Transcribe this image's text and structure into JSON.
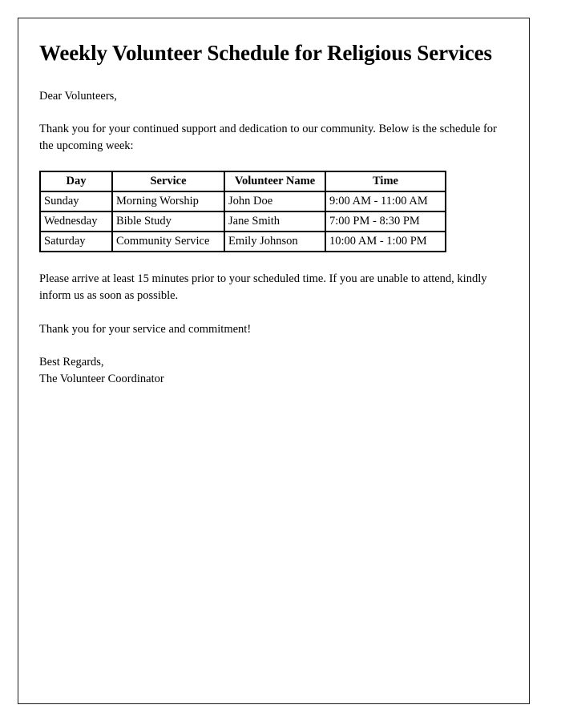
{
  "document": {
    "title": "Weekly Volunteer Schedule for Religious Services",
    "salutation": "Dear Volunteers,",
    "intro_paragraph": "Thank you for your continued support and dedication to our community. Below is the schedule for the upcoming week:",
    "notice_paragraph": "Please arrive at least 15 minutes prior to your scheduled time. If you are unable to attend, kindly inform us as soon as possible.",
    "thanks_paragraph": "Thank you for your service and commitment!",
    "signoff": "Best Regards,",
    "signer": "The Volunteer Coordinator"
  },
  "schedule_table": {
    "headers": {
      "day": "Day",
      "service": "Service",
      "volunteer": "Volunteer Name",
      "time": "Time"
    },
    "rows": [
      {
        "day": "Sunday",
        "service": "Morning Worship",
        "volunteer": "John Doe",
        "time": "9:00 AM - 11:00 AM"
      },
      {
        "day": "Wednesday",
        "service": "Bible Study",
        "volunteer": "Jane Smith",
        "time": "7:00 PM - 8:30 PM"
      },
      {
        "day": "Saturday",
        "service": "Community Service",
        "volunteer": "Emily Johnson",
        "time": "10:00 AM - 1:00 PM"
      }
    ]
  },
  "colors": {
    "text": "#000000",
    "border": "#000000",
    "page_border": "#1a1a1a",
    "background": "#ffffff"
  }
}
